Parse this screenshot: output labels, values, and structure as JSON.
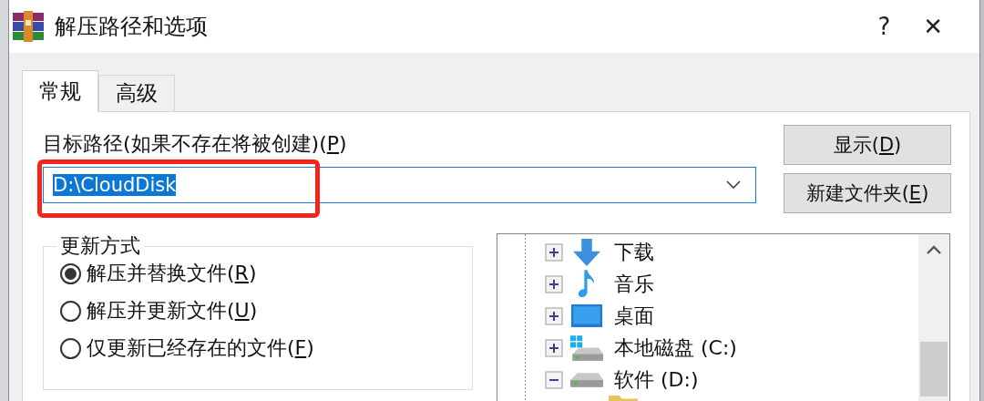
{
  "window": {
    "title": "解压路径和选项",
    "help": "?",
    "close": "✕"
  },
  "tabs": [
    {
      "label": "常规",
      "selected": true
    },
    {
      "label": "高级",
      "selected": false
    }
  ],
  "path_label": {
    "text": "目标路径(如果不存在将被创建)(P)",
    "mnemonic": true
  },
  "path_field": {
    "value": "D:\\CloudDisk",
    "text_selected": true,
    "highlighted": true
  },
  "buttons": [
    {
      "label": "显示(D)",
      "mnemonic": true
    },
    {
      "label": "新建文件夹(E)",
      "mnemonic": true
    }
  ],
  "update_mode": {
    "title": "更新方式",
    "options": [
      {
        "label": "解压并替换文件(R)",
        "mnemonic": true,
        "selected": true
      },
      {
        "label": "解压并更新文件(U)",
        "mnemonic": true,
        "selected": false
      },
      {
        "label": "仅更新已经存在的文件(F)",
        "mnemonic": true,
        "selected": false
      }
    ]
  },
  "folder_tree": {
    "items": [
      {
        "kind": "download",
        "label": "下载",
        "expanded": false
      },
      {
        "kind": "music",
        "label": "音乐",
        "expanded": false
      },
      {
        "kind": "desktop",
        "label": "桌面",
        "expanded": false
      },
      {
        "kind": "system_drive",
        "label": "本地磁盘 (C:)",
        "expanded": false
      },
      {
        "kind": "drive",
        "label": "软件 (D:)",
        "expanded": true,
        "children": [
          {
            "kind": "folder"
          }
        ]
      }
    ]
  }
}
